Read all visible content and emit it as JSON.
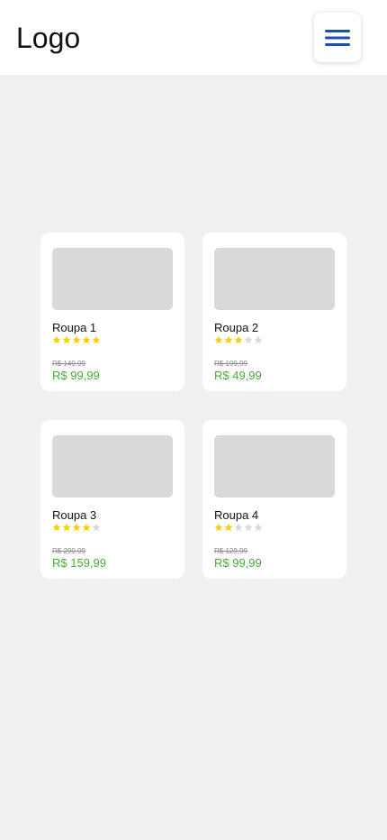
{
  "header": {
    "logo_text": "Logo",
    "menu_icon": "hamburger-menu-icon",
    "menu_color": "#1c4fb0"
  },
  "colors": {
    "background": "#f0f0f0",
    "card": "#ffffff",
    "placeholder": "#d9d9d9",
    "price": "#4caa3a",
    "old_price": "#888888",
    "star_filled": "#f2d20f",
    "star_empty": "#d9d9d9"
  },
  "products": [
    {
      "name": "Roupa 1",
      "rating": 5,
      "max_rating": 5,
      "old_price": "R$ 149,99",
      "price": "R$ 99,99"
    },
    {
      "name": "Roupa 2",
      "rating": 3,
      "max_rating": 5,
      "old_price": "R$ 199,99",
      "price": "R$ 49,99"
    },
    {
      "name": "Roupa 3",
      "rating": 4,
      "max_rating": 5,
      "old_price": "R$ 299,99",
      "price": "R$ 159,99"
    },
    {
      "name": "Roupa 4",
      "rating": 2,
      "max_rating": 5,
      "old_price": "R$ 129,99",
      "price": "R$ 99,99"
    }
  ]
}
